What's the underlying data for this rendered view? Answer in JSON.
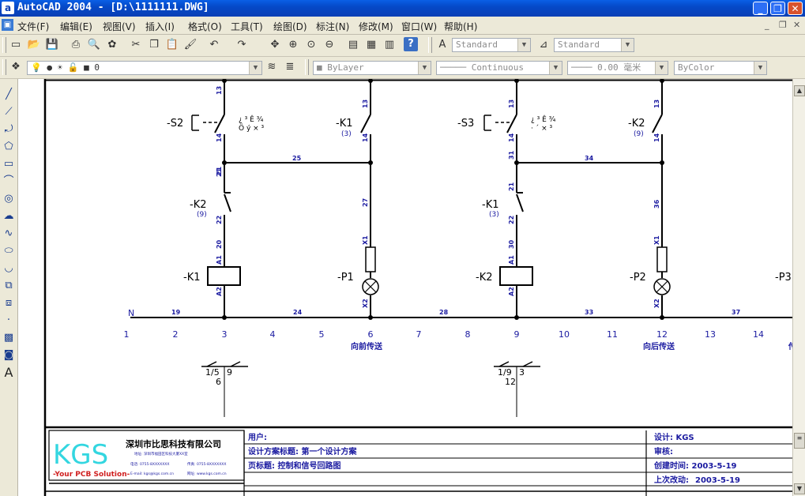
{
  "window": {
    "title": "AutoCAD 2004 - [D:\\1111111.DWG]",
    "app_icon": "a",
    "btn_min": "_",
    "btn_max": "❐",
    "btn_close": "✕"
  },
  "menu": {
    "items": [
      "文件(F)",
      "编辑(E)",
      "视图(V)",
      "插入(I)",
      "格式(O)",
      "工具(T)",
      "绘图(D)",
      "标注(N)",
      "修改(M)",
      "窗口(W)",
      "帮助(H)"
    ],
    "mdi_min": "_",
    "mdi_restore": "❐",
    "mdi_close": "✕"
  },
  "toolbar1": {
    "text_style": "Standard",
    "dim_style": "Standard"
  },
  "toolbar2": {
    "layer": "0",
    "color": "ByLayer",
    "linetype": "Continuous",
    "lineweight": "0.00 毫米",
    "plotstyle": "ByColor"
  },
  "drawing": {
    "components": {
      "s2": "-S2",
      "s3": "-S3",
      "k1_contact": "-K1",
      "k1_contact_ref": "(3)",
      "k2_contact_top": "-K2",
      "k2_contact_top_ref": "(9)",
      "k2_nc": "-K2",
      "k2_nc_ref": "(9)",
      "k1_nc": "-K1",
      "k1_nc_ref": "(3)",
      "k1_coil": "-K1",
      "p1": "-P1",
      "k2_coil": "-K2",
      "p2": "-P2",
      "p3": "-P3",
      "s2_note_1": "¿ ³ Ê ¾",
      "s2_note_2": "Ö ý × ³",
      "s3_note_1": "¿ ³ Ê ¾",
      "s3_note_2": "· ´ × ³"
    },
    "pins": {
      "s2_a": "13",
      "s2_b": "14",
      "k1_a": "13",
      "k1_b": "14",
      "s3_a": "13",
      "s3_b": "14",
      "k2_a": "13",
      "k2_b": "14",
      "k2nc_a": "21",
      "k2nc_b": "22",
      "k1nc_a": "21",
      "k1nc_b": "22",
      "coil1_a": "A1",
      "coil1_b": "A2",
      "coil2_a": "A1",
      "coil2_b": "A2",
      "lamp1_a": "X1",
      "lamp1_b": "X2",
      "lamp2_a": "X1",
      "lamp2_b": "X2"
    },
    "wires": {
      "w25": "25",
      "w21": "21",
      "w20": "20",
      "w27": "27",
      "w34": "34",
      "w31": "31",
      "w30": "30",
      "w36": "36",
      "w19": "19",
      "w24": "24",
      "w28": "28",
      "w33": "33",
      "w37": "37",
      "neutral": "N"
    },
    "columns": [
      "1",
      "2",
      "3",
      "4",
      "5",
      "6",
      "7",
      "8",
      "9",
      "10",
      "11",
      "12",
      "13",
      "14"
    ],
    "labels": {
      "forward": "向前传送",
      "backward": "向后传送",
      "edge": "传"
    },
    "cross_refs": {
      "k1_left": "1/5",
      "k1_right": "9",
      "k1_bottom": "6",
      "k2_left": "1/9",
      "k2_right": "3",
      "k2_bottom": "12"
    },
    "title_block": {
      "logo": "KGS",
      "logo_tagline": "-Your PCB Solution-",
      "company": "深圳市比思科技有限公司",
      "company_addr": "地址: 深圳市福田区科技大厦XX室",
      "phone": "电话: 0755-8XXXXXXX",
      "fax": "传真: 0755-8XXXXXXX",
      "email": "E-mail: kgs@kgs.com.cn",
      "web": "网址: www.kgs.com.cn",
      "user": "用户:",
      "design_title": "设计方案标题: 第一个设计方案",
      "page_title": "页标题: 控制和信号回路图",
      "designer": "设计: KGS",
      "reviewer": "审核:",
      "created": "创建时间: 2003-5-19",
      "modified_label": "上次改动:",
      "modified_date": "2003-5-19"
    }
  }
}
